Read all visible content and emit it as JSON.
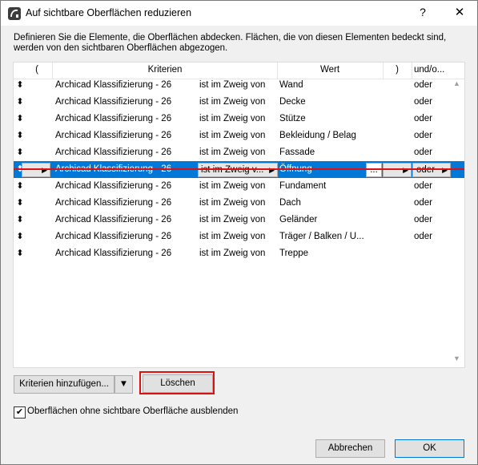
{
  "window": {
    "title": "Auf sichtbare Oberflächen reduzieren",
    "help": "?",
    "close": "✕"
  },
  "description": "Definieren Sie die Elemente, die Oberflächen abdecken. Flächen, die von diesen Elementen bedeckt sind, werden von den sichtbaren Oberflächen abgezogen.",
  "table": {
    "headers": {
      "open_paren": "(",
      "criteria": "Kriterien",
      "value": "Wert",
      "close_paren": ")",
      "andor": "und/o..."
    },
    "rows": [
      {
        "criterion": "Archicad Klassifizierung - 26",
        "operator": "ist im Zweig von",
        "value": "Wand",
        "conjunction": "oder"
      },
      {
        "criterion": "Archicad Klassifizierung - 26",
        "operator": "ist im Zweig von",
        "value": "Decke",
        "conjunction": "oder"
      },
      {
        "criterion": "Archicad Klassifizierung - 26",
        "operator": "ist im Zweig von",
        "value": "Stütze",
        "conjunction": "oder"
      },
      {
        "criterion": "Archicad Klassifizierung - 26",
        "operator": "ist im Zweig von",
        "value": "Bekleidung / Belag",
        "conjunction": "oder"
      },
      {
        "criterion": "Archicad Klassifizierung - 26",
        "operator": "ist im Zweig von",
        "value": "Fassade",
        "conjunction": "oder"
      },
      {
        "criterion": "Archicad Klassifizierung - 26",
        "operator": "ist im Zweig v...",
        "value": "Öffnung",
        "conjunction": "oder",
        "selected": true
      },
      {
        "criterion": "Archicad Klassifizierung - 26",
        "operator": "ist im Zweig von",
        "value": "Fundament",
        "conjunction": "oder"
      },
      {
        "criterion": "Archicad Klassifizierung - 26",
        "operator": "ist im Zweig von",
        "value": "Dach",
        "conjunction": "oder"
      },
      {
        "criterion": "Archicad Klassifizierung - 26",
        "operator": "ist im Zweig von",
        "value": "Geländer",
        "conjunction": "oder"
      },
      {
        "criterion": "Archicad Klassifizierung - 26",
        "operator": "ist im Zweig von",
        "value": "Träger / Balken / U...",
        "conjunction": "oder"
      },
      {
        "criterion": "Archicad Klassifizierung - 26",
        "operator": "ist im Zweig von",
        "value": "Treppe",
        "conjunction": ""
      }
    ],
    "selected_value_more": "..."
  },
  "buttons": {
    "add_criteria": "Kriterien hinzufügen...",
    "delete": "Löschen",
    "cancel": "Abbrechen",
    "ok": "OK"
  },
  "checkbox": {
    "label": "Oberflächen ohne sichtbare Oberfläche ausblenden",
    "checked": true
  },
  "colors": {
    "selection": "#0078d7",
    "highlight": "#e01010"
  }
}
